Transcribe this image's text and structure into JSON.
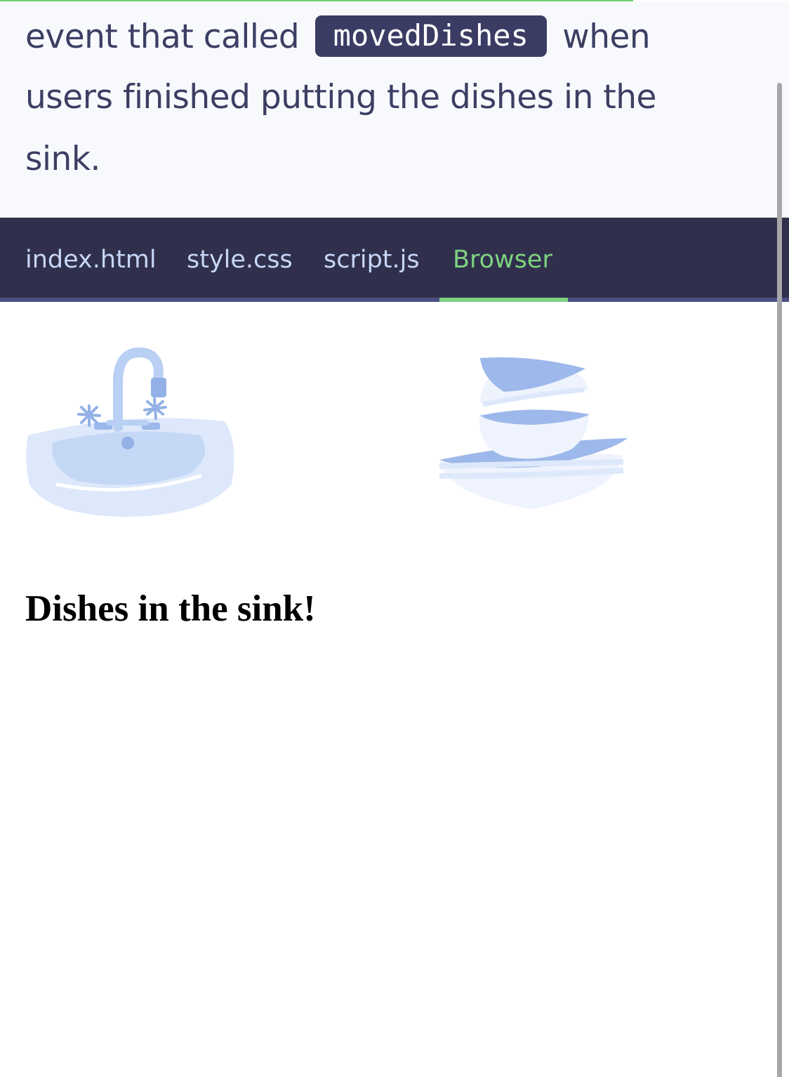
{
  "lesson": {
    "line1_before": "event that called",
    "code_term": "movedDishes",
    "line1_after": "when",
    "line2": "users finished putting the dishes in the",
    "line3": "sink."
  },
  "tabs": [
    {
      "label": "index.html",
      "active": false
    },
    {
      "label": "style.css",
      "active": false
    },
    {
      "label": "script.js",
      "active": false
    },
    {
      "label": "Browser",
      "active": true
    }
  ],
  "browser": {
    "heading": "Dishes in the sink!",
    "images": [
      "sink-icon",
      "dish-stack-icon"
    ]
  },
  "colors": {
    "accent_green": "#7ed27f",
    "tabbar_bg": "#30304d",
    "text": "#3c3f63",
    "illustration_blue": "#9db8ea"
  }
}
